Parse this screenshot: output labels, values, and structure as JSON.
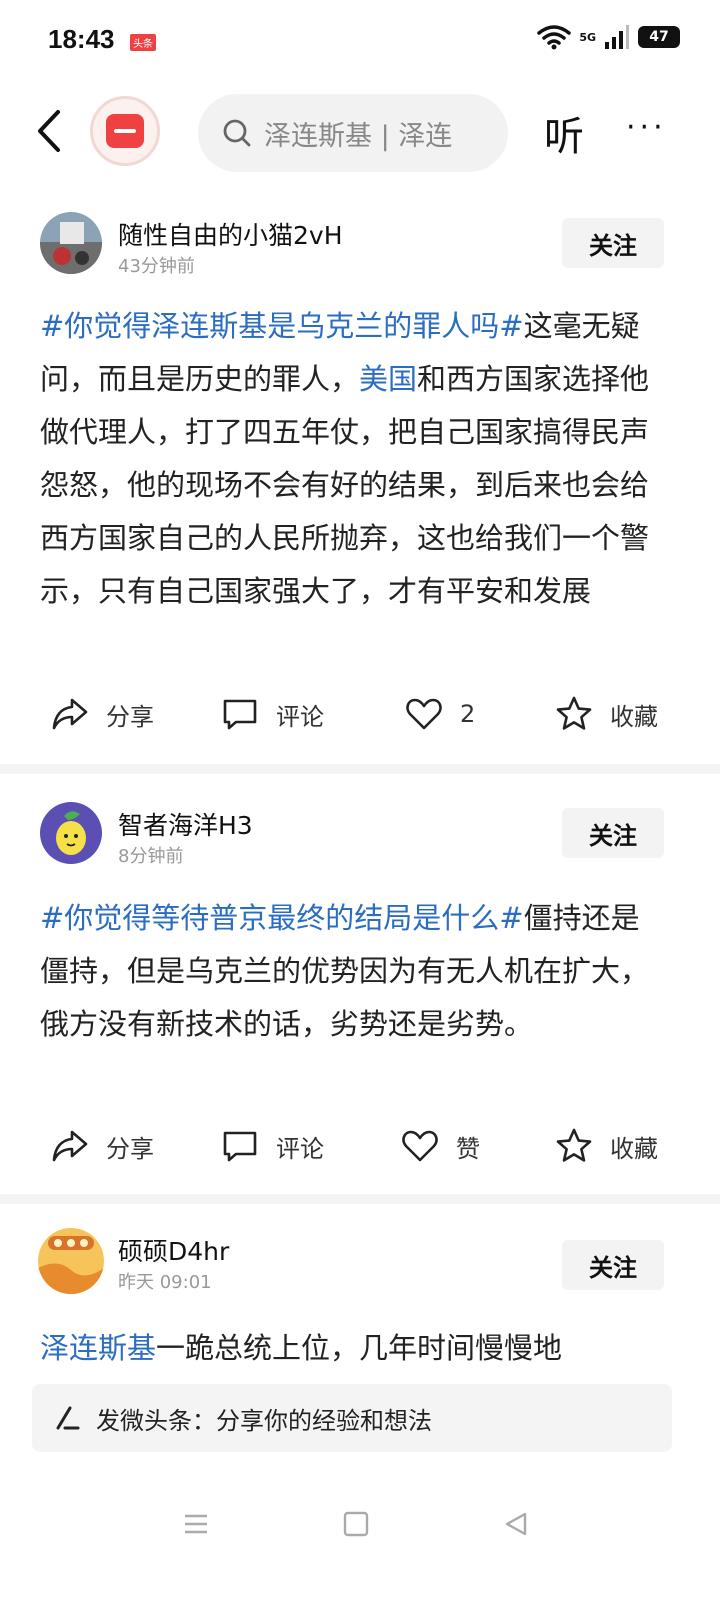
{
  "status_bar": {
    "time": "18:43",
    "app_badge": "头条",
    "network": "5G",
    "battery": "47"
  },
  "top_nav": {
    "search_text": "泽连斯基 | 泽连",
    "listen_label": "听",
    "more_label": "···"
  },
  "posts": [
    {
      "username": "随性自由的小猫2vH",
      "time": "43分钟前",
      "follow_label": "关注",
      "hashtag": "#你觉得泽连斯基是乌克兰的罪人吗#",
      "text_a": "这毫无疑问，而且是历史的罪人，",
      "link": "美国",
      "text_b": "和西方国家选择他做代理人，打了四五年仗，把自己国家搞得民声怨怒，他的现场不会有好的结果，到后来也会给西方国家自己的人民所抛弃，这也给我们一个警示，只有自己国家强大了，才有平安和发展",
      "share_label": "分享",
      "comment_label": "评论",
      "like_label": "2",
      "favorite_label": "收藏"
    },
    {
      "username": "智者海洋H3",
      "time": "8分钟前",
      "follow_label": "关注",
      "hashtag": "#你觉得等待普京最终的结局是什么#",
      "text_a": "僵持还是僵持，但是乌克兰的优势因为有无人机在扩大，俄方没有新技术的话，劣势还是劣势。",
      "share_label": "分享",
      "comment_label": "评论",
      "like_label": "赞",
      "favorite_label": "收藏"
    },
    {
      "username": "硕硕D4hr",
      "time": "昨天  09:01",
      "follow_label": "关注",
      "link": "泽连斯基",
      "text_a": "一跪总统上位，几年时间慢慢地"
    }
  ],
  "compose": {
    "placeholder": "发微头条：分享你的经验和想法"
  }
}
